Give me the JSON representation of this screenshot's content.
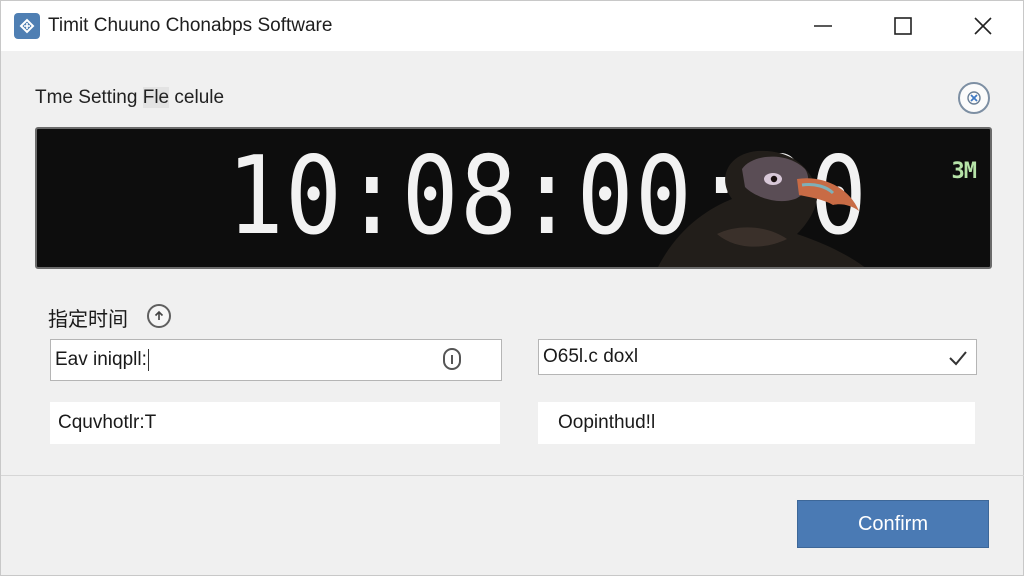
{
  "window": {
    "title": "Timit Chuuno Chonabps Software",
    "icon": "app-logo-icon",
    "controls": [
      "minimize-icon",
      "maximize-icon",
      "close-icon"
    ]
  },
  "dialog": {
    "section_title_prefix": "Tme Setting ",
    "section_title_highlight": "Fle",
    "section_title_suffix": " celule",
    "help_icon": "help-icon"
  },
  "clock": {
    "display_text": "10:08:00:00",
    "badge": "3M",
    "text_color": "#f2f2f2",
    "background_color": "#0d0d0d",
    "badge_color": "#b6e3a8",
    "image": "vulture-image"
  },
  "form": {
    "label": "指定时间",
    "label_icon": "arrow-up-icon",
    "field_1": {
      "value": "Eav iniqpll:"
    },
    "field_2": {
      "value": "O65l.c doxl"
    },
    "field_3": {
      "value": "Cquvhotlr:T"
    },
    "field_4": {
      "value": "Oopinthud!l"
    }
  },
  "footer": {
    "confirm_label": "Confirm"
  },
  "colors": {
    "accent": "#4a7ab4",
    "window_background": "#f0f0f0"
  }
}
